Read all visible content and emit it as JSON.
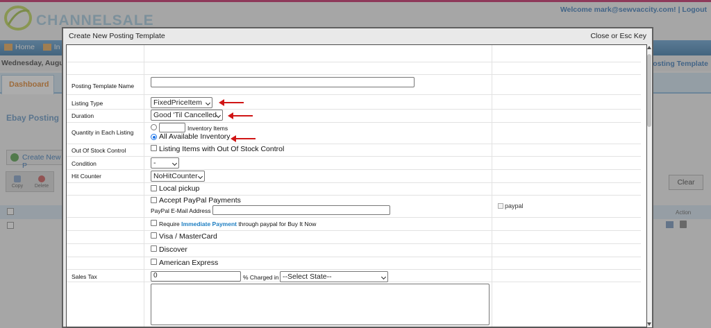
{
  "app": {
    "logo_text": "CHANNELSALE",
    "welcome": "Welcome mark@sewvaccity.com! | Logout",
    "nav_home": "Home",
    "nav_item2": "In",
    "date": "Wednesday, August",
    "ebay_template_link": "y Posting Template",
    "dashboard_tab": "Dashboard",
    "section_title": "Ebay Posting",
    "create_new": "Create New P",
    "copy": "Copy",
    "delete": "Delete",
    "clear": "Clear",
    "action": "Action"
  },
  "modal": {
    "title": "Create New Posting Template",
    "close": "Close or Esc Key"
  },
  "form": {
    "template_name_label": "Posting Template Name",
    "template_name_value": "",
    "listing_type_label": "Listing Type",
    "listing_type_value": "FixedPriceItem",
    "duration_label": "Duration",
    "duration_value": "Good 'Til Cancelled",
    "quantity_label": "Quantity in Each Listing",
    "inventory_items_label": "Inventory Items",
    "all_inventory_label": "All Available Inventory",
    "out_of_stock_label": "Out Of Stock Control",
    "out_of_stock_option": "Listing Items with Out Of Stock Control",
    "condition_label": "Condition",
    "condition_value": "-",
    "hit_counter_label": "Hit Counter",
    "hit_counter_value": "NoHitCounter",
    "local_pickup": "Local pickup",
    "accept_paypal": "Accept PayPal Payments",
    "paypal_email_label": "PayPal E-Mail Address",
    "paypal_img_alt": "paypal",
    "require_prefix": "Require",
    "immediate_payment": "Immediate Payment",
    "require_suffix": "through paypal for Buy It Now",
    "visa": "Visa / MasterCard",
    "discover": "Discover",
    "amex": "American Express",
    "sales_tax_label": "Sales Tax",
    "sales_tax_value": "0",
    "charged_in": "% Charged in",
    "state_value": "--Select State--"
  }
}
